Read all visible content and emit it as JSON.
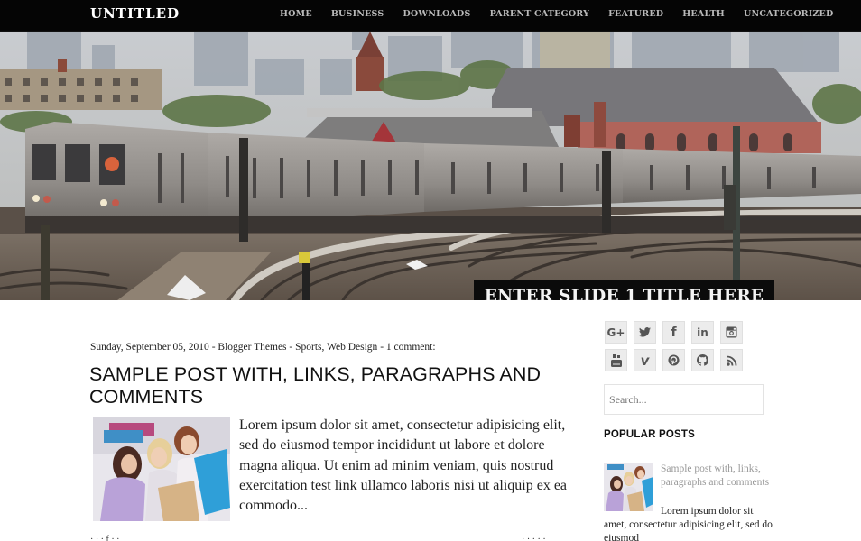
{
  "header": {
    "brand": "UNTITLED",
    "nav": [
      {
        "label": "HOME"
      },
      {
        "label": "BUSINESS"
      },
      {
        "label": "DOWNLOADS"
      },
      {
        "label": "PARENT CATEGORY"
      },
      {
        "label": "FEATURED"
      },
      {
        "label": "HEALTH"
      },
      {
        "label": "UNCATEGORIZED"
      }
    ]
  },
  "slider": {
    "image_desc": "elevated subway train on curved tracks with city skyline and church",
    "slide_title": "ENTER SLIDE 1 TITLE HERE"
  },
  "post": {
    "date": "Sunday, September 05, 2010",
    "author": "Blogger Themes",
    "labels": "Sports, Web Design",
    "comments": "1 comment:",
    "separator": " - ",
    "title": "SAMPLE POST WITH, LINKS, PARAGRAPHS AND COMMENTS",
    "thumbnail_desc": "three women with shopping bags",
    "excerpt": "Lorem ipsum dolor sit amet, consectetur adipisicing elit, sed do eiusmod tempor incididunt ut labore et dolore magna aliqua. Ut enim ad minim veniam, quis nostrud exercitation test link ullamco laboris nisi ut aliquip ex ea commodo..."
  },
  "sidebar": {
    "social": [
      {
        "icon": "google-plus-icon",
        "glyph": "G+"
      },
      {
        "icon": "twitter-icon"
      },
      {
        "icon": "facebook-icon",
        "glyph": "f"
      },
      {
        "icon": "linkedin-icon",
        "glyph": "in"
      },
      {
        "icon": "instagram-icon"
      },
      {
        "icon": "youtube-icon"
      },
      {
        "icon": "vimeo-icon",
        "glyph": "v"
      },
      {
        "icon": "pinterest-icon"
      },
      {
        "icon": "github-icon"
      },
      {
        "icon": "rss-icon"
      }
    ],
    "search_placeholder": "Search...",
    "popular_title": "POPULAR POSTS",
    "popular_posts": [
      {
        "title": "Sample post with, links, paragraphs and comments",
        "snippet": "Lorem ipsum dolor sit amet, consectetur adipisicing elit, sed do eiusmod"
      }
    ]
  },
  "colors": {
    "topbar_bg": "#050505",
    "nav_text": "#b9b9b9",
    "slide_title_bg": "#0b0b0b",
    "social_btn_bg": "#ececec",
    "popular_link": "#999999"
  }
}
